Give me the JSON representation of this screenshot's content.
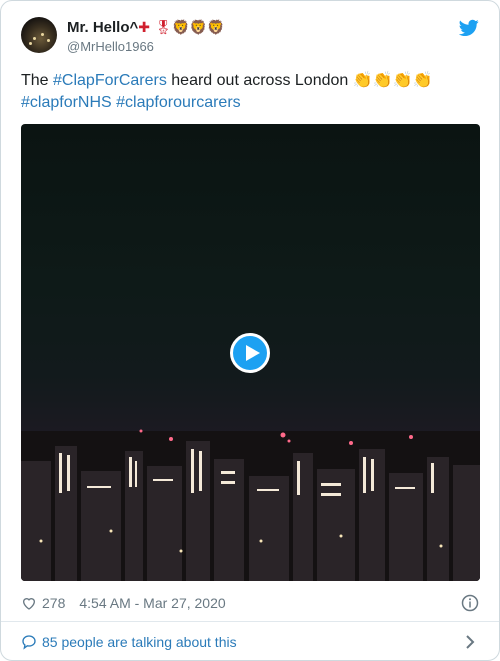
{
  "tweet": {
    "display_name": "Mr. Hello^",
    "name_emojis": "✚ 🎖🦁🦁🦁",
    "handle": "@MrHello1966",
    "text_prefix": "The ",
    "hashtag_1": "#ClapForCarers",
    "text_middle": " heard out across London ",
    "claps": "👏👏👏👏",
    "hashtag_2": "#clapforNHS",
    "hashtag_3": "#clapforourcarers",
    "like_count": "278",
    "timestamp": "4:54 AM - Mar 27, 2020",
    "conversation": "85 people are talking about this"
  },
  "icons": {
    "logo": "twitter-bird-icon",
    "play": "play-icon",
    "like": "heart-icon",
    "info": "info-icon",
    "conversation": "speech-bubble-icon",
    "expand": "chevron-right-icon"
  },
  "colors": {
    "link": "#2b7bb9",
    "brand": "#1da1f2",
    "muted": "#697882",
    "border": "#cfd9de"
  }
}
